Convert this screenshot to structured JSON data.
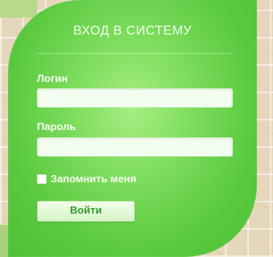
{
  "form": {
    "title": "ВХОД В СИСТЕМУ",
    "login_label": "Логин",
    "login_value": "",
    "password_label": "Пароль",
    "password_value": "",
    "remember_label": "Запомнить меня",
    "remember_checked": false,
    "submit_label": "Войти"
  },
  "colors": {
    "panel_green": "#5ac93f",
    "panel_highlight": "#a8ee84",
    "background": "#e6d7bb",
    "button_text": "#3a9a2a"
  }
}
